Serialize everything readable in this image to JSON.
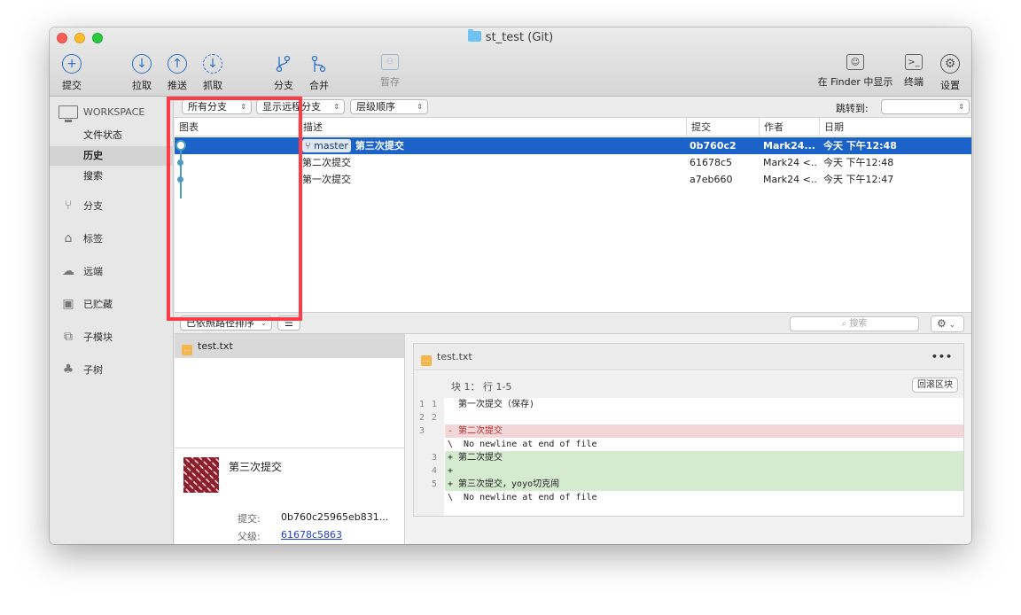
{
  "window": {
    "title": "st_test (Git)"
  },
  "toolbar": {
    "commit": "提交",
    "pull": "拉取",
    "push": "推送",
    "fetch": "抓取",
    "branch": "分支",
    "merge": "合并",
    "stash": "暂存",
    "finder": "在 Finder 中显示",
    "terminal": "终端",
    "settings": "设置"
  },
  "sidebar": {
    "workspace": "WORKSPACE",
    "file_status": "文件状态",
    "history": "历史",
    "search": "搜索",
    "branches": "分支",
    "tags": "标签",
    "remotes": "远端",
    "stashes": "已贮藏",
    "submodules": "子模块",
    "subtrees": "子树"
  },
  "filters": {
    "branches": "所有分支",
    "remote": "显示远程分支",
    "order": "层级顺序",
    "jump_to": "跳转到:"
  },
  "columns": {
    "graph": "图表",
    "description": "描述",
    "commit": "提交",
    "author": "作者",
    "date": "日期"
  },
  "commits": [
    {
      "branch": "master",
      "description": "第三次提交",
      "hash": "0b760c2",
      "author": "Mark24...",
      "date": "今天 下午12:48",
      "selected": true
    },
    {
      "branch": "",
      "description": "第二次提交",
      "hash": "61678c5",
      "author": "Mark24 <...",
      "date": "今天 下午12:48",
      "selected": false
    },
    {
      "branch": "",
      "description": "第一次提交",
      "hash": "a7eb660",
      "author": "Mark24 <...",
      "date": "今天 下午12:47",
      "selected": false
    }
  ],
  "lower_bar": {
    "sort": "已依照路径排序",
    "search_placeholder": "搜索"
  },
  "files": [
    {
      "name": "test.txt"
    }
  ],
  "commit_detail": {
    "title": "第三次提交",
    "commit_label": "提交:",
    "commit_value": "0b760c25965eb831...",
    "parent_label": "父级:",
    "parent_value": "61678c5863"
  },
  "diff": {
    "file": "test.txt",
    "more": "•••",
    "hunk_title": "块 1： 行 1-5",
    "revert": "回滚区块",
    "lines": [
      {
        "old": "1",
        "new": "1",
        "type": "ctx",
        "text": "  第一次提交（保存)"
      },
      {
        "old": "2",
        "new": "2",
        "type": "ctx",
        "text": ""
      },
      {
        "old": "3",
        "new": "",
        "type": "del",
        "text": "- 第二次提交"
      },
      {
        "old": "",
        "new": "",
        "type": "ctx",
        "text": "\\  No newline at end of file"
      },
      {
        "old": "",
        "new": "3",
        "type": "add",
        "text": "+ 第二次提交"
      },
      {
        "old": "",
        "new": "4",
        "type": "add",
        "text": "+"
      },
      {
        "old": "",
        "new": "5",
        "type": "add",
        "text": "+ 第三次提交，yoyo切克闹"
      },
      {
        "old": "",
        "new": "",
        "type": "ctx",
        "text": "\\  No newline at end of file"
      }
    ]
  },
  "colors": {
    "selection": "#1b63c9",
    "accent": "#2a6fc9",
    "highlight_box": "#ff3b45",
    "deleted": "#f3d7d8",
    "added": "#d5ebd0"
  }
}
